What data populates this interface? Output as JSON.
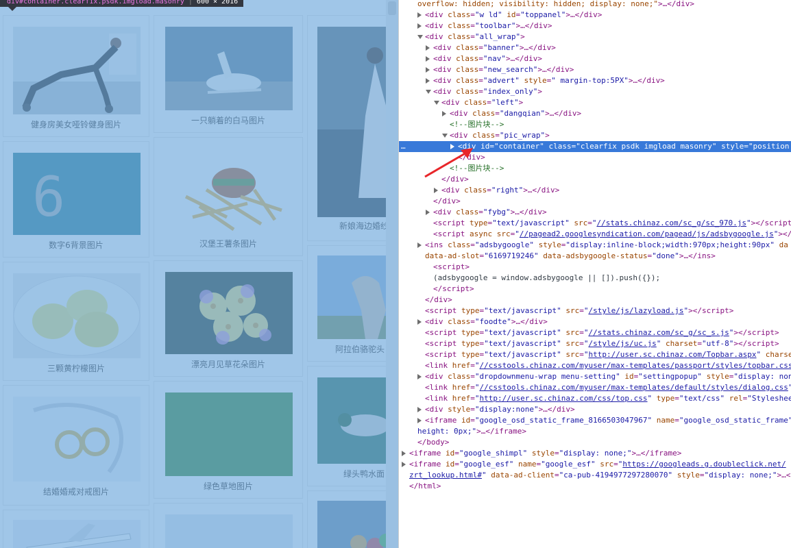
{
  "preview": {
    "tooltip": {
      "selector": "div#container.clearfix.psdk.imgload.masonry",
      "size": "600 × 2016"
    },
    "cards": [
      {
        "caption": "健身房美女哑铃健身图片",
        "theme": "gym"
      },
      {
        "caption": "一只躺着的白马图片",
        "theme": "horse"
      },
      {
        "caption": "新娘海边婚纱",
        "theme": "bride"
      },
      {
        "caption": "数字6背景图片",
        "theme": "six"
      },
      {
        "caption": "汉堡王薯条图片",
        "theme": "burger"
      },
      {
        "caption": "阿拉伯骆驼头",
        "theme": "camel"
      },
      {
        "caption": "三颗黄柠檬图片",
        "theme": "lemon"
      },
      {
        "caption": "漂亮月见草花朵图片",
        "theme": "flower"
      },
      {
        "caption": "绿头鸭水面",
        "theme": "duck"
      },
      {
        "caption": "结婚婚戒对戒图片",
        "theme": "rings"
      },
      {
        "caption": "绿色草地图片",
        "theme": "grass"
      },
      {
        "caption": "",
        "theme": "plane"
      },
      {
        "caption": "",
        "theme": "sky"
      },
      {
        "caption": "",
        "theme": "balls"
      }
    ],
    "six_glyph": "6"
  },
  "devtools": {
    "lines": [
      {
        "html": "<span class=\"an\">overflow: hidden; visibility: hidden; display: none;\"</span><span class=\"tg\">&gt;…&lt;/div&gt;</span>"
      },
      {
        "html": "<span class=\"tg\">&lt;div </span><span class=\"an\">class</span><span class=\"tg\">=</span><span class=\"av\">\"w ld\"</span> <span class=\"an\">id</span><span class=\"tg\">=</span><span class=\"av\">\"toppanel\"</span><span class=\"tg\">&gt;…&lt;/div&gt;</span>"
      },
      {
        "html": "<span class=\"tg\">&lt;div </span><span class=\"an\">class</span><span class=\"tg\">=</span><span class=\"av\">\"toolbar\"</span><span class=\"tg\">&gt;…&lt;/div&gt;</span>"
      },
      {
        "html": "<span class=\"tg\">&lt;div </span><span class=\"an\">class</span><span class=\"tg\">=</span><span class=\"av\">\"all_wrap\"</span><span class=\"tg\">&gt;</span>"
      },
      {
        "html": "<span class=\"tg\">&lt;div </span><span class=\"an\">class</span><span class=\"tg\">=</span><span class=\"av\">\"banner\"</span><span class=\"tg\">&gt;…&lt;/div&gt;</span>"
      },
      {
        "html": "<span class=\"tg\">&lt;div </span><span class=\"an\">class</span><span class=\"tg\">=</span><span class=\"av\">\"nav\"</span><span class=\"tg\">&gt;…&lt;/div&gt;</span>"
      },
      {
        "html": "<span class=\"tg\">&lt;div </span><span class=\"an\">class</span><span class=\"tg\">=</span><span class=\"av\">\"new_search\"</span><span class=\"tg\">&gt;…&lt;/div&gt;</span>"
      },
      {
        "html": "<span class=\"tg\">&lt;div </span><span class=\"an\">class</span><span class=\"tg\">=</span><span class=\"av\">\"advert\"</span> <span class=\"an\">style</span><span class=\"tg\">=</span><span class=\"av\">\" margin-top:5PX\"</span><span class=\"tg\">&gt;…&lt;/div&gt;</span>"
      },
      {
        "html": "<span class=\"tg\">&lt;div </span><span class=\"an\">class</span><span class=\"tg\">=</span><span class=\"av\">\"index_only\"</span><span class=\"tg\">&gt;</span>"
      },
      {
        "html": "<span class=\"tg\">&lt;div </span><span class=\"an\">class</span><span class=\"tg\">=</span><span class=\"av\">\"left\"</span><span class=\"tg\">&gt;</span>"
      },
      {
        "html": "<span class=\"tg\">&lt;div </span><span class=\"an\">class</span><span class=\"tg\">=</span><span class=\"av\">\"dangqian\"</span><span class=\"tg\">&gt;…&lt;/div&gt;</span>"
      },
      {
        "html": "<span class=\"cm\">&lt;!--图片块--&gt;</span>"
      },
      {
        "html": "<span class=\"tg\">&lt;div </span><span class=\"an\">class</span><span class=\"tg\">=</span><span class=\"av\">\"pic_wrap\"</span><span class=\"tg\">&gt;</span>"
      },
      {
        "html": "<span class=\"tg\">&lt;div </span><span class=\"an\">id</span><span class=\"tg\">=</span><span class=\"av\">\"container\"</span> <span class=\"an\">class</span><span class=\"tg\">=</span><span class=\"av\">\"clearfix psdk imgload masonry\"</span> <span class=\"an\">style</span><span class=\"tg\">=</span><span class=\"av\">\"position:</span>"
      },
      {
        "html": "<span class=\"tg\">&lt;/div&gt;</span>"
      },
      {
        "html": "<span class=\"cm\">&lt;!--图片块--&gt;</span>"
      },
      {
        "html": "<span class=\"tg\">&lt;/div&gt;</span>"
      },
      {
        "html": "<span class=\"tg\">&lt;div </span><span class=\"an\">class</span><span class=\"tg\">=</span><span class=\"av\">\"right\"</span><span class=\"tg\">&gt;…&lt;/div&gt;</span>"
      },
      {
        "html": "<span class=\"tg\">&lt;/div&gt;</span>"
      },
      {
        "html": "<span class=\"tg\">&lt;div </span><span class=\"an\">class</span><span class=\"tg\">=</span><span class=\"av\">\"fybg\"</span><span class=\"tg\">&gt;…&lt;/div&gt;</span>"
      },
      {
        "html": "<span class=\"tg\">&lt;script </span><span class=\"an\">type</span><span class=\"tg\">=</span><span class=\"av\">\"text/javascript\"</span> <span class=\"an\">src</span><span class=\"tg\">=</span><span class=\"av\">\"</span><span class=\"lk\">//stats.chinaz.com/sc_g/sc_970.js</span><span class=\"av\">\"</span><span class=\"tg\">&gt;&lt;/script</span>"
      },
      {
        "html": "<span class=\"tg\">&lt;script </span><span class=\"an\">async</span> <span class=\"an\">src</span><span class=\"tg\">=</span><span class=\"av\">\"</span><span class=\"lk\">//pagead2.googlesyndication.com/pagead/js/adsbygoogle.js</span><span class=\"av\">\"</span><span class=\"tg\">&gt;&lt;/s</span>"
      },
      {
        "html": "<span class=\"tg\">&lt;ins </span><span class=\"an\">class</span><span class=\"tg\">=</span><span class=\"av\">\"adsbygoogle\"</span> <span class=\"an\">style</span><span class=\"tg\">=</span><span class=\"av\">\"display:inline-block;width:970px;height:90px\"</span> <span class=\"an\">da</span>"
      },
      {
        "html": "<span class=\"an\">data-ad-slot</span><span class=\"tg\">=</span><span class=\"av\">\"6169719246\"</span> <span class=\"an\">data-adsbygoogle-status</span><span class=\"tg\">=</span><span class=\"av\">\"done\"</span><span class=\"tg\">&gt;…&lt;/ins&gt;</span>"
      },
      {
        "html": "<span class=\"tg\">&lt;script&gt;</span>"
      },
      {
        "html": "<span class=\"tx\">(adsbygoogle = window.adsbygoogle || []).push({});</span>"
      },
      {
        "html": "<span class=\"tg\">&lt;/script&gt;</span>"
      },
      {
        "html": "<span class=\"tg\">&lt;/div&gt;</span>"
      },
      {
        "html": "<span class=\"tg\">&lt;script </span><span class=\"an\">type</span><span class=\"tg\">=</span><span class=\"av\">\"text/javascript\"</span> <span class=\"an\">src</span><span class=\"tg\">=</span><span class=\"av\">\"</span><span class=\"lk\">/style/js/lazyload.js</span><span class=\"av\">\"</span><span class=\"tg\">&gt;&lt;/script&gt;</span>"
      },
      {
        "html": "<span class=\"tg\">&lt;div </span><span class=\"an\">class</span><span class=\"tg\">=</span><span class=\"av\">\"foodte\"</span><span class=\"tg\">&gt;…&lt;/div&gt;</span>"
      },
      {
        "html": "<span class=\"tg\">&lt;script </span><span class=\"an\">type</span><span class=\"tg\">=</span><span class=\"av\">\"text/javascript\"</span> <span class=\"an\">src</span><span class=\"tg\">=</span><span class=\"av\">\"</span><span class=\"lk\">//stats.chinaz.com/sc_g/sc_s.js</span><span class=\"av\">\"</span><span class=\"tg\">&gt;&lt;/script&gt;</span>"
      },
      {
        "html": "<span class=\"tg\">&lt;script </span><span class=\"an\">type</span><span class=\"tg\">=</span><span class=\"av\">\"text/javascript\"</span> <span class=\"an\">src</span><span class=\"tg\">=</span><span class=\"av\">\"</span><span class=\"lk\">/style/js/uc.js</span><span class=\"av\">\"</span> <span class=\"an\">charset</span><span class=\"tg\">=</span><span class=\"av\">\"utf-8\"</span><span class=\"tg\">&gt;&lt;/script&gt;</span>"
      },
      {
        "html": "<span class=\"tg\">&lt;script </span><span class=\"an\">type</span><span class=\"tg\">=</span><span class=\"av\">\"text/javascript\"</span> <span class=\"an\">src</span><span class=\"tg\">=</span><span class=\"av\">\"</span><span class=\"lk\">http://user.sc.chinaz.com/Topbar.aspx</span><span class=\"av\">\"</span> <span class=\"an\">charse</span>"
      },
      {
        "html": "<span class=\"tg\">&lt;link </span><span class=\"an\">href</span><span class=\"tg\">=</span><span class=\"av\">\"</span><span class=\"lk\">//csstools.chinaz.com/myuser/max-templates/passport/styles/topbar.css</span>"
      },
      {
        "html": "<span class=\"tg\">&lt;div </span><span class=\"an\">class</span><span class=\"tg\">=</span><span class=\"av\">\"dropdownmenu-wrap menu-setting\"</span> <span class=\"an\">id</span><span class=\"tg\">=</span><span class=\"av\">\"settingpopup\"</span> <span class=\"an\">style</span><span class=\"tg\">=</span><span class=\"av\">\"display: none</span>"
      },
      {
        "html": "<span class=\"tg\">&lt;link </span><span class=\"an\">href</span><span class=\"tg\">=</span><span class=\"av\">\"</span><span class=\"lk\">//csstools.chinaz.com/myuser/max-templates/default/styles/dialog.css</span><span class=\"av\">\"</span>"
      },
      {
        "html": "<span class=\"tg\">&lt;link </span><span class=\"an\">href</span><span class=\"tg\">=</span><span class=\"av\">\"</span><span class=\"lk\">http://user.sc.chinaz.com/css/top.css</span><span class=\"av\">\"</span> <span class=\"an\">type</span><span class=\"tg\">=</span><span class=\"av\">\"text/css\"</span> <span class=\"an\">rel</span><span class=\"tg\">=</span><span class=\"av\">\"Styleshee</span>"
      },
      {
        "html": "<span class=\"tg\">&lt;div </span><span class=\"an\">style</span><span class=\"tg\">=</span><span class=\"av\">\"display:none\"</span><span class=\"tg\">&gt;…&lt;/div&gt;</span>"
      },
      {
        "html": "<span class=\"tg\">&lt;iframe </span><span class=\"an\">id</span><span class=\"tg\">=</span><span class=\"av\">\"google_osd_static_frame_8166503047967\"</span> <span class=\"an\">name</span><span class=\"tg\">=</span><span class=\"av\">\"google_osd_static_frame\"</span>"
      },
      {
        "html": "<span class=\"av\">height: 0px;\"</span><span class=\"tg\">&gt;…&lt;/iframe&gt;</span>"
      },
      {
        "html": "<span class=\"tg\">&lt;/body&gt;</span>"
      },
      {
        "html": "<span class=\"tg\">&lt;iframe </span><span class=\"an\">id</span><span class=\"tg\">=</span><span class=\"av\">\"google_shimpl\"</span> <span class=\"an\">style</span><span class=\"tg\">=</span><span class=\"av\">\"display: none;\"</span><span class=\"tg\">&gt;…&lt;/iframe&gt;</span>"
      },
      {
        "html": "<span class=\"tg\">&lt;iframe </span><span class=\"an\">id</span><span class=\"tg\">=</span><span class=\"av\">\"google_esf\"</span> <span class=\"an\">name</span><span class=\"tg\">=</span><span class=\"av\">\"google_esf\"</span> <span class=\"an\">src</span><span class=\"tg\">=</span><span class=\"av\">\"</span><span class=\"lk\">https://googleads.g.doubleclick.net/</span>"
      },
      {
        "html": "<span class=\"lk\">zrt_lookup.html#</span><span class=\"av\">\"</span> <span class=\"an\">data-ad-client</span><span class=\"tg\">=</span><span class=\"av\">\"ca-pub-4194977297280070\"</span> <span class=\"an\">style</span><span class=\"tg\">=</span><span class=\"av\">\"display: none;\"</span><span class=\"tg\">&gt;…&lt;/</span>"
      },
      {
        "html": "<span class=\"tg\">&lt;/html&gt;</span>"
      }
    ]
  }
}
